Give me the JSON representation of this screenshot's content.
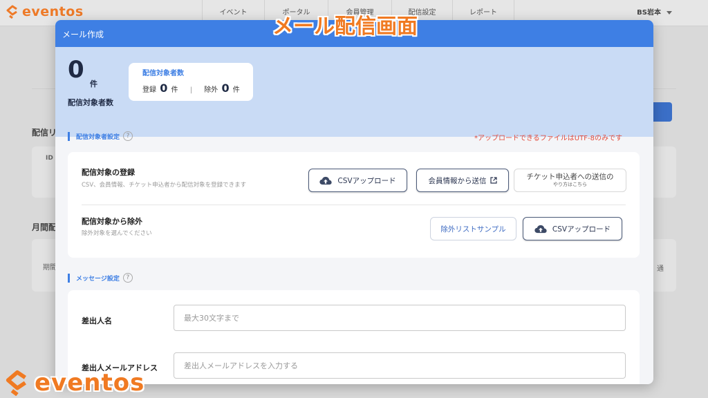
{
  "app": {
    "logo": "eventos",
    "nav": [
      {
        "label": "イベント"
      },
      {
        "label": "ポータル"
      },
      {
        "label": "会員管理"
      },
      {
        "label": "配信設定"
      },
      {
        "label": "レポート"
      }
    ],
    "user": "BS岩本"
  },
  "background": {
    "section1": "配信リ",
    "col_id": "ID",
    "section2": "月間配",
    "period": "期間",
    "right_label": "通"
  },
  "overlay": {
    "title": "メール配信画面",
    "watermark": "eventos"
  },
  "modal": {
    "title": "メール作成",
    "summary": {
      "count": "0",
      "unit": "件",
      "label": "配信対象者数",
      "box_title": "配信対象者数",
      "registered_label": "登録",
      "registered_count": "0",
      "registered_unit": "件",
      "separator": "|",
      "excluded_label": "除外",
      "excluded_count": "0",
      "excluded_unit": "件"
    },
    "target_settings": {
      "heading": "配信対象者設定",
      "help": "?",
      "note": "*アップロードできるファイルはUTF-8のみです",
      "register": {
        "title": "配信対象の登録",
        "subtitle": "CSV、会員情報、チケット申込者から配信対象を登録できます",
        "csv_button": "CSVアップロード",
        "member_button": "会員情報から送信",
        "ticket_button": "チケット申込者への送信の",
        "ticket_button_sub": "やり方はこちら"
      },
      "exclude": {
        "title": "配信対象から除外",
        "subtitle": "除外対象を選んでください",
        "sample_button": "除外リストサンプル",
        "csv_button": "CSVアップロード"
      }
    },
    "message_settings": {
      "heading": "メッセージ設定",
      "help": "?",
      "sender_name_label": "差出人名",
      "sender_name_placeholder": "最大30文字まで",
      "sender_email_label": "差出人メールアドレス",
      "sender_email_placeholder": "差出人メールアドレスを入力する"
    }
  },
  "colors": {
    "accent": "#3e7fe4",
    "brand": "#f07a22",
    "warning": "#e24a3b"
  }
}
